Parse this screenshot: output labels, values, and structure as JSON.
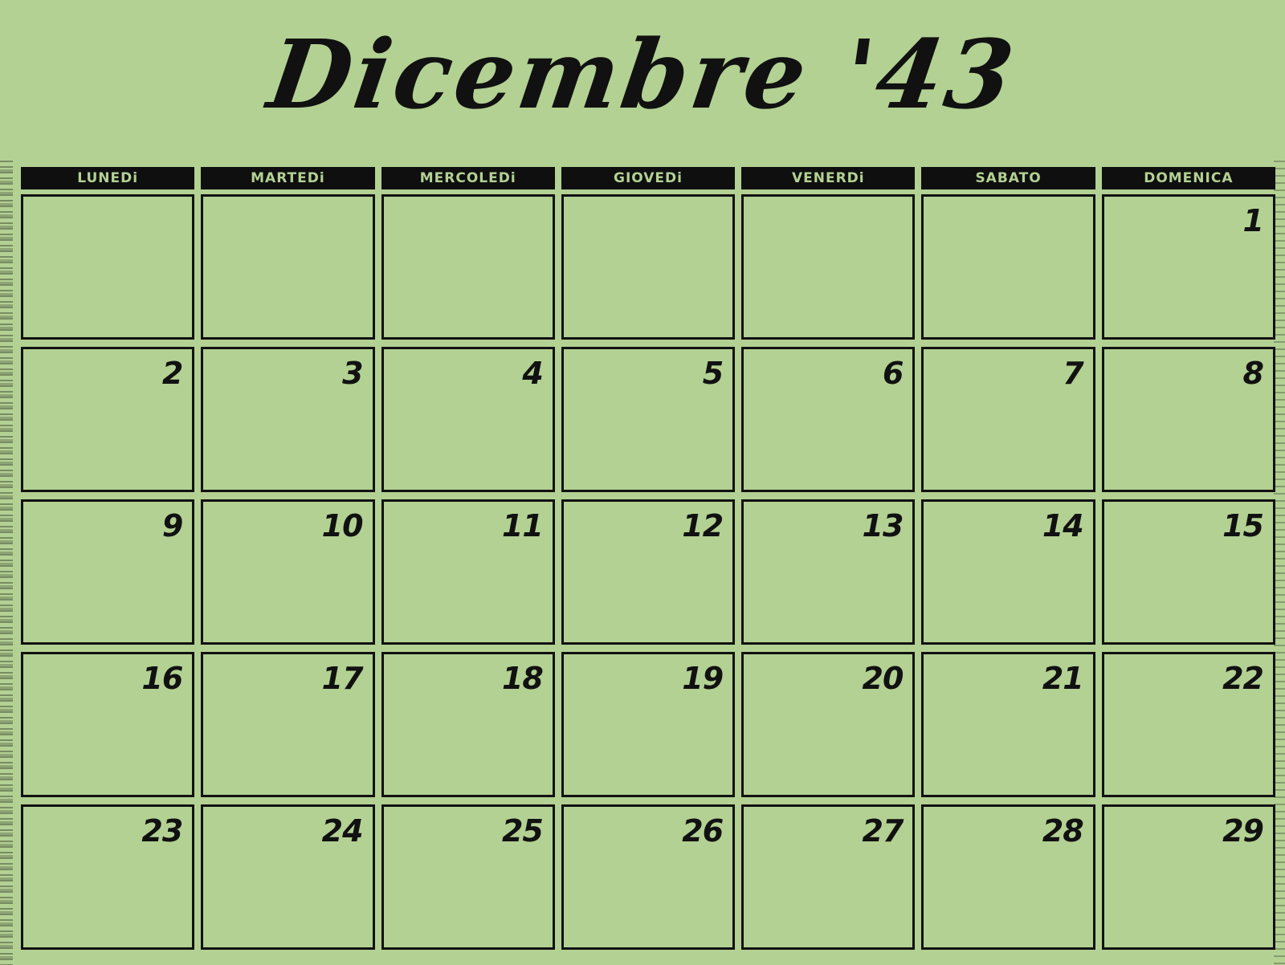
{
  "title": "Dicembre '43",
  "weekdays": [
    "LUNEDi",
    "MARTEDi",
    "MERCOLEDi",
    "GIOVEDi",
    "VENERDi",
    "SABATO",
    "DOMENICA"
  ],
  "weeks": [
    [
      "",
      "",
      "",
      "",
      "",
      "",
      "1"
    ],
    [
      "2",
      "3",
      "4",
      "5",
      "6",
      "7",
      "8"
    ],
    [
      "9",
      "10",
      "11",
      "12",
      "13",
      "14",
      "15"
    ],
    [
      "16",
      "17",
      "18",
      "19",
      "20",
      "21",
      "22"
    ],
    [
      "23",
      "24",
      "25",
      "26",
      "27",
      "28",
      "29"
    ]
  ],
  "colors": {
    "background": "#b3d193",
    "ink": "#111111"
  }
}
